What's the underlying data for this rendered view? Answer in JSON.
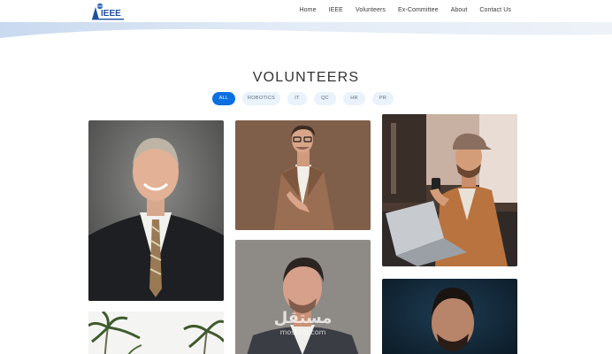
{
  "brand": {
    "logo_text": "IEEE"
  },
  "nav": {
    "items": [
      "Home",
      "IEEE",
      "Volunteers",
      "Ex-Committee",
      "About",
      "Contact Us"
    ]
  },
  "section": {
    "title": "VOLUNTEERS"
  },
  "filters": {
    "items": [
      "ALL",
      "ROBOTICS",
      "IT",
      "QC",
      "HR",
      "PR"
    ],
    "active": "ALL"
  },
  "watermark": {
    "text": "مستقل",
    "sub": "mostaql.com"
  },
  "colors": {
    "accent": "#0b6fe0",
    "pill_bg": "#eaf2fb",
    "logo_blue": "#1f4fa0"
  }
}
